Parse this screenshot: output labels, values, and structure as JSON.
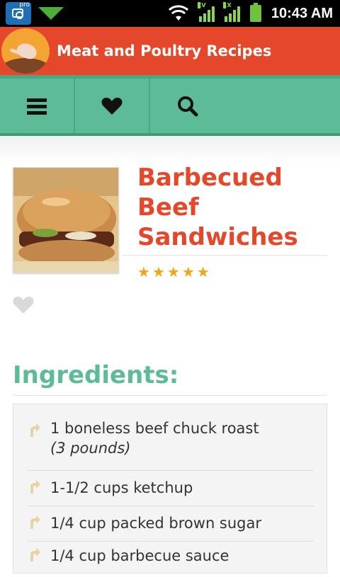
{
  "status_bar": {
    "camera_badge": "pro",
    "signal_1_tag": "EV",
    "signal_2_tag": "1X",
    "time": "10:43 AM"
  },
  "app": {
    "title": "Meat and Poultry Recipes",
    "accent_color": "#e5472a",
    "toolbar_color": "#5dbc97"
  },
  "toolbar": {
    "buttons": [
      "menu-icon",
      "favorites-heart-icon",
      "search-icon"
    ]
  },
  "recipe": {
    "title": "Barbecued Beef Sandwiches",
    "rating": 5,
    "rating_max": 5,
    "favorited": false
  },
  "ingredients": {
    "heading": "Ingredients:",
    "items": [
      {
        "text": "1 boneless beef chuck roast",
        "note": "(3 pounds)"
      },
      {
        "text": "1-1/2 cups ketchup"
      },
      {
        "text": "1/4 cup packed brown sugar"
      },
      {
        "text": "1/4 cup barbecue sauce"
      }
    ]
  }
}
